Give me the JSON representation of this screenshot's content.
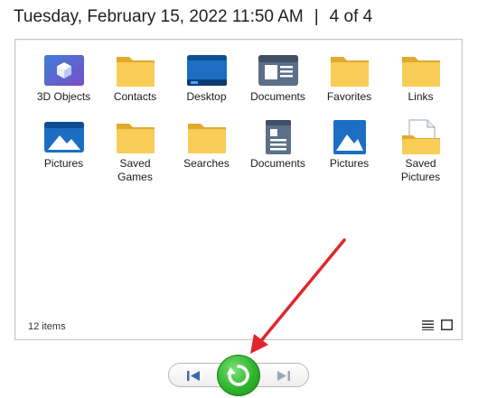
{
  "header": {
    "datetime": "Tuesday, February 15, 2022 11:50 AM",
    "separator": "|",
    "position": "4 of 4"
  },
  "items": [
    {
      "label": "3D Objects",
      "icon": "3d-objects-icon"
    },
    {
      "label": "Contacts",
      "icon": "folder-icon"
    },
    {
      "label": "Desktop",
      "icon": "desktop-folder-icon"
    },
    {
      "label": "Documents",
      "icon": "documents-folder-icon"
    },
    {
      "label": "Favorites",
      "icon": "folder-icon"
    },
    {
      "label": "Links",
      "icon": "folder-icon"
    },
    {
      "label": "Pictures",
      "icon": "pictures-folder-icon"
    },
    {
      "label": "Saved Games",
      "icon": "folder-icon"
    },
    {
      "label": "Searches",
      "icon": "folder-icon"
    },
    {
      "label": "Documents",
      "icon": "documents-library-icon"
    },
    {
      "label": "Pictures",
      "icon": "pictures-library-icon"
    },
    {
      "label": "Saved Pictures",
      "icon": "saved-pictures-folder-icon"
    }
  ],
  "status": {
    "count": "12 items"
  },
  "colors": {
    "folder": "#f5c94f",
    "annotation_arrow": "#e0262d",
    "rotate_button": "#2eb52b"
  }
}
